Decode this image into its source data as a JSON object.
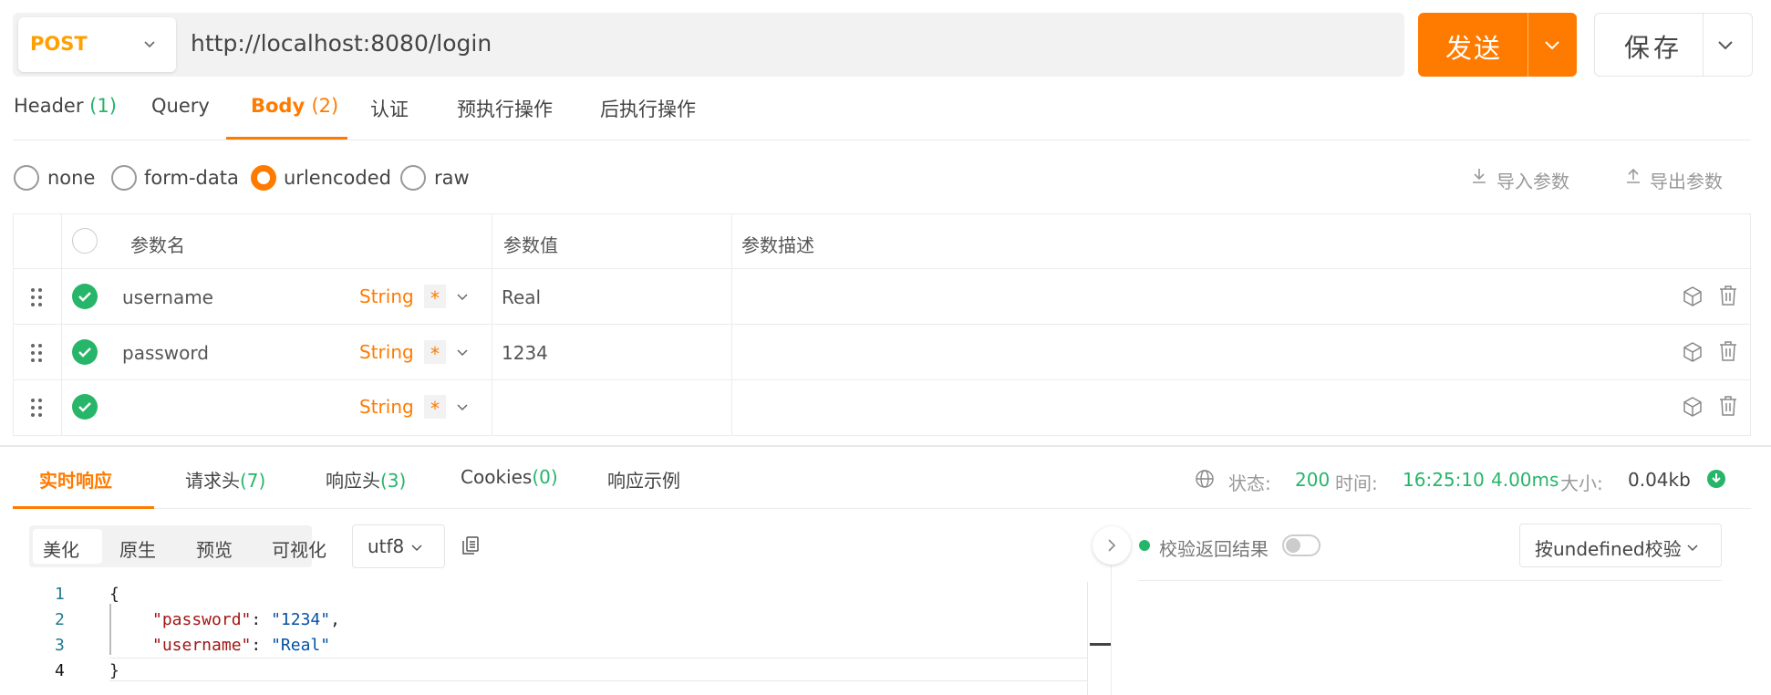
{
  "request": {
    "method": "POST",
    "url": "http://localhost:8080/login",
    "send_label": "发送",
    "save_label": "保存"
  },
  "request_tabs": [
    {
      "label": "Header",
      "count": "(1)"
    },
    {
      "label": "Query",
      "count": ""
    },
    {
      "label": "Body",
      "count": "(2)",
      "active": true
    },
    {
      "label": "认证",
      "count": ""
    },
    {
      "label": "预执行操作",
      "count": ""
    },
    {
      "label": "后执行操作",
      "count": ""
    }
  ],
  "body_types": {
    "options": [
      "none",
      "form-data",
      "urlencoded",
      "raw"
    ],
    "selected": "urlencoded",
    "import_label": "导入参数",
    "export_label": "导出参数"
  },
  "params_table": {
    "headers": [
      "参数名",
      "参数值",
      "参数描述"
    ],
    "rows": [
      {
        "name": "username",
        "type": "String",
        "required": "*",
        "value": "Real",
        "description": ""
      },
      {
        "name": "password",
        "type": "String",
        "required": "*",
        "value": "1234",
        "description": ""
      },
      {
        "name": "",
        "type": "String",
        "required": "*",
        "value": "",
        "description": ""
      }
    ]
  },
  "response_tabs": [
    {
      "label": "实时响应",
      "count": "",
      "active": true
    },
    {
      "label": "请求头",
      "count": "(7)"
    },
    {
      "label": "响应头",
      "count": "(3)"
    },
    {
      "label": "Cookies",
      "count": "(0)"
    },
    {
      "label": "响应示例",
      "count": ""
    }
  ],
  "response_meta": {
    "status_label": "状态:",
    "status": "200",
    "time_label": "时间:",
    "time": "16:25:10",
    "duration": "4.00ms",
    "size_label": "大小:",
    "size": "0.04kb"
  },
  "view_modes": {
    "options": [
      "美化",
      "原生",
      "预览",
      "可视化"
    ],
    "selected": "美化",
    "encoding": "utf8"
  },
  "code": {
    "line_numbers": [
      "1",
      "2",
      "3",
      "4"
    ],
    "open_brace": "{",
    "close_brace": "}",
    "entries": [
      {
        "key": "\"password\"",
        "colon": ": ",
        "value": "\"1234\"",
        "comma": ","
      },
      {
        "key": "\"username\"",
        "colon": ": ",
        "value": "\"Real\"",
        "comma": ""
      }
    ]
  },
  "validation": {
    "label": "校验返回结果",
    "enabled": false,
    "select_label": "按undefined校验"
  },
  "colors": {
    "accent": "#ff7b00",
    "success": "#27b56a",
    "method": "#ffa000"
  },
  "icons": [
    "chevron-down-icon",
    "download-icon",
    "upload-icon",
    "drag-handle-icon",
    "check-circle-icon",
    "cube-icon",
    "trash-icon",
    "globe-icon",
    "download-circle-icon",
    "copy-icon",
    "chevron-right-icon"
  ]
}
